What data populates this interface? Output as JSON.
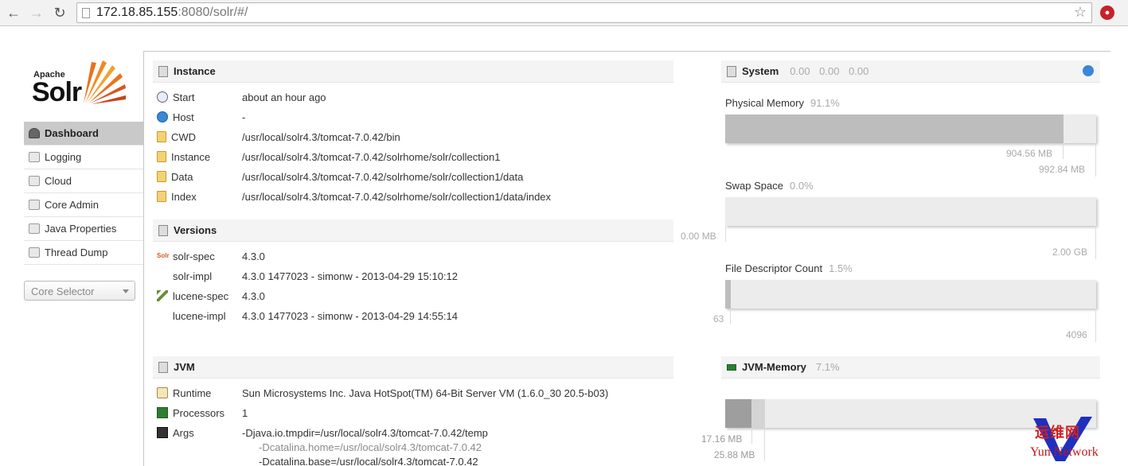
{
  "browser": {
    "url_host": "172.18.85.155",
    "url_rest": ":8080/solr/#/"
  },
  "logo": {
    "apache": "Apache",
    "solr": "Solr"
  },
  "menu": {
    "items": [
      {
        "label": "Dashboard"
      },
      {
        "label": "Logging"
      },
      {
        "label": "Cloud"
      },
      {
        "label": "Core Admin"
      },
      {
        "label": "Java Properties"
      },
      {
        "label": "Thread Dump"
      }
    ],
    "core_selector": "Core Selector"
  },
  "instance": {
    "title": "Instance",
    "rows": [
      {
        "key": "Start",
        "value": "about an hour ago"
      },
      {
        "key": "Host",
        "value": "-"
      },
      {
        "key": "CWD",
        "value": "/usr/local/solr4.3/tomcat-7.0.42/bin"
      },
      {
        "key": "Instance",
        "value": "/usr/local/solr4.3/tomcat-7.0.42/solrhome/solr/collection1"
      },
      {
        "key": "Data",
        "value": "/usr/local/solr4.3/tomcat-7.0.42/solrhome/solr/collection1/data"
      },
      {
        "key": "Index",
        "value": "/usr/local/solr4.3/tomcat-7.0.42/solrhome/solr/collection1/data/index"
      }
    ]
  },
  "versions": {
    "title": "Versions",
    "rows": [
      {
        "key": "solr-spec",
        "value": "4.3.0"
      },
      {
        "key": "solr-impl",
        "value": "4.3.0 1477023 - simonw - 2013-04-29 15:10:12"
      },
      {
        "key": "lucene-spec",
        "value": "4.3.0"
      },
      {
        "key": "lucene-impl",
        "value": "4.3.0 1477023 - simonw - 2013-04-29 14:55:14"
      }
    ]
  },
  "jvm": {
    "title": "JVM",
    "rows": [
      {
        "key": "Runtime",
        "value": "Sun Microsystems Inc. Java HotSpot(TM) 64-Bit Server VM (1.6.0_30 20.5-b03)"
      },
      {
        "key": "Processors",
        "value": "1"
      },
      {
        "key": "Args",
        "value": "-Djava.io.tmpdir=/usr/local/solr4.3/tomcat-7.0.42/temp"
      }
    ],
    "args_more": [
      "-Dcatalina.home=/usr/local/solr4.3/tomcat-7.0.42",
      "-Dcatalina.base=/usr/local/solr4.3/tomcat-7.0.42"
    ]
  },
  "system": {
    "title": "System",
    "load": "0.00 0.00 0.00",
    "physical": {
      "label": "Physical Memory",
      "pct": "91.1%",
      "used": "904.56 MB",
      "total": "992.84 MB",
      "fraction": 0.911
    },
    "swap": {
      "label": "Swap Space",
      "pct": "0.0%",
      "used": "0.00 MB",
      "total": "2.00 GB",
      "fraction": 0.0
    },
    "fd": {
      "label": "File Descriptor Count",
      "pct": "1.5%",
      "used": "63",
      "total": "4096",
      "fraction": 0.015
    }
  },
  "jvm_memory": {
    "title": "JVM-Memory",
    "pct": "7.1%",
    "used": "17.16 MB",
    "committed": "25.88 MB",
    "used_fraction": 0.071,
    "committed_fraction": 0.107
  },
  "watermark": {
    "cn": "运维网",
    "en": "Yun Network"
  },
  "colors": {
    "active_menu": "#c9c9c9",
    "bar_used": "#bdbdbd",
    "bar_track": "#ececec",
    "refresh": "#3b86d8"
  }
}
